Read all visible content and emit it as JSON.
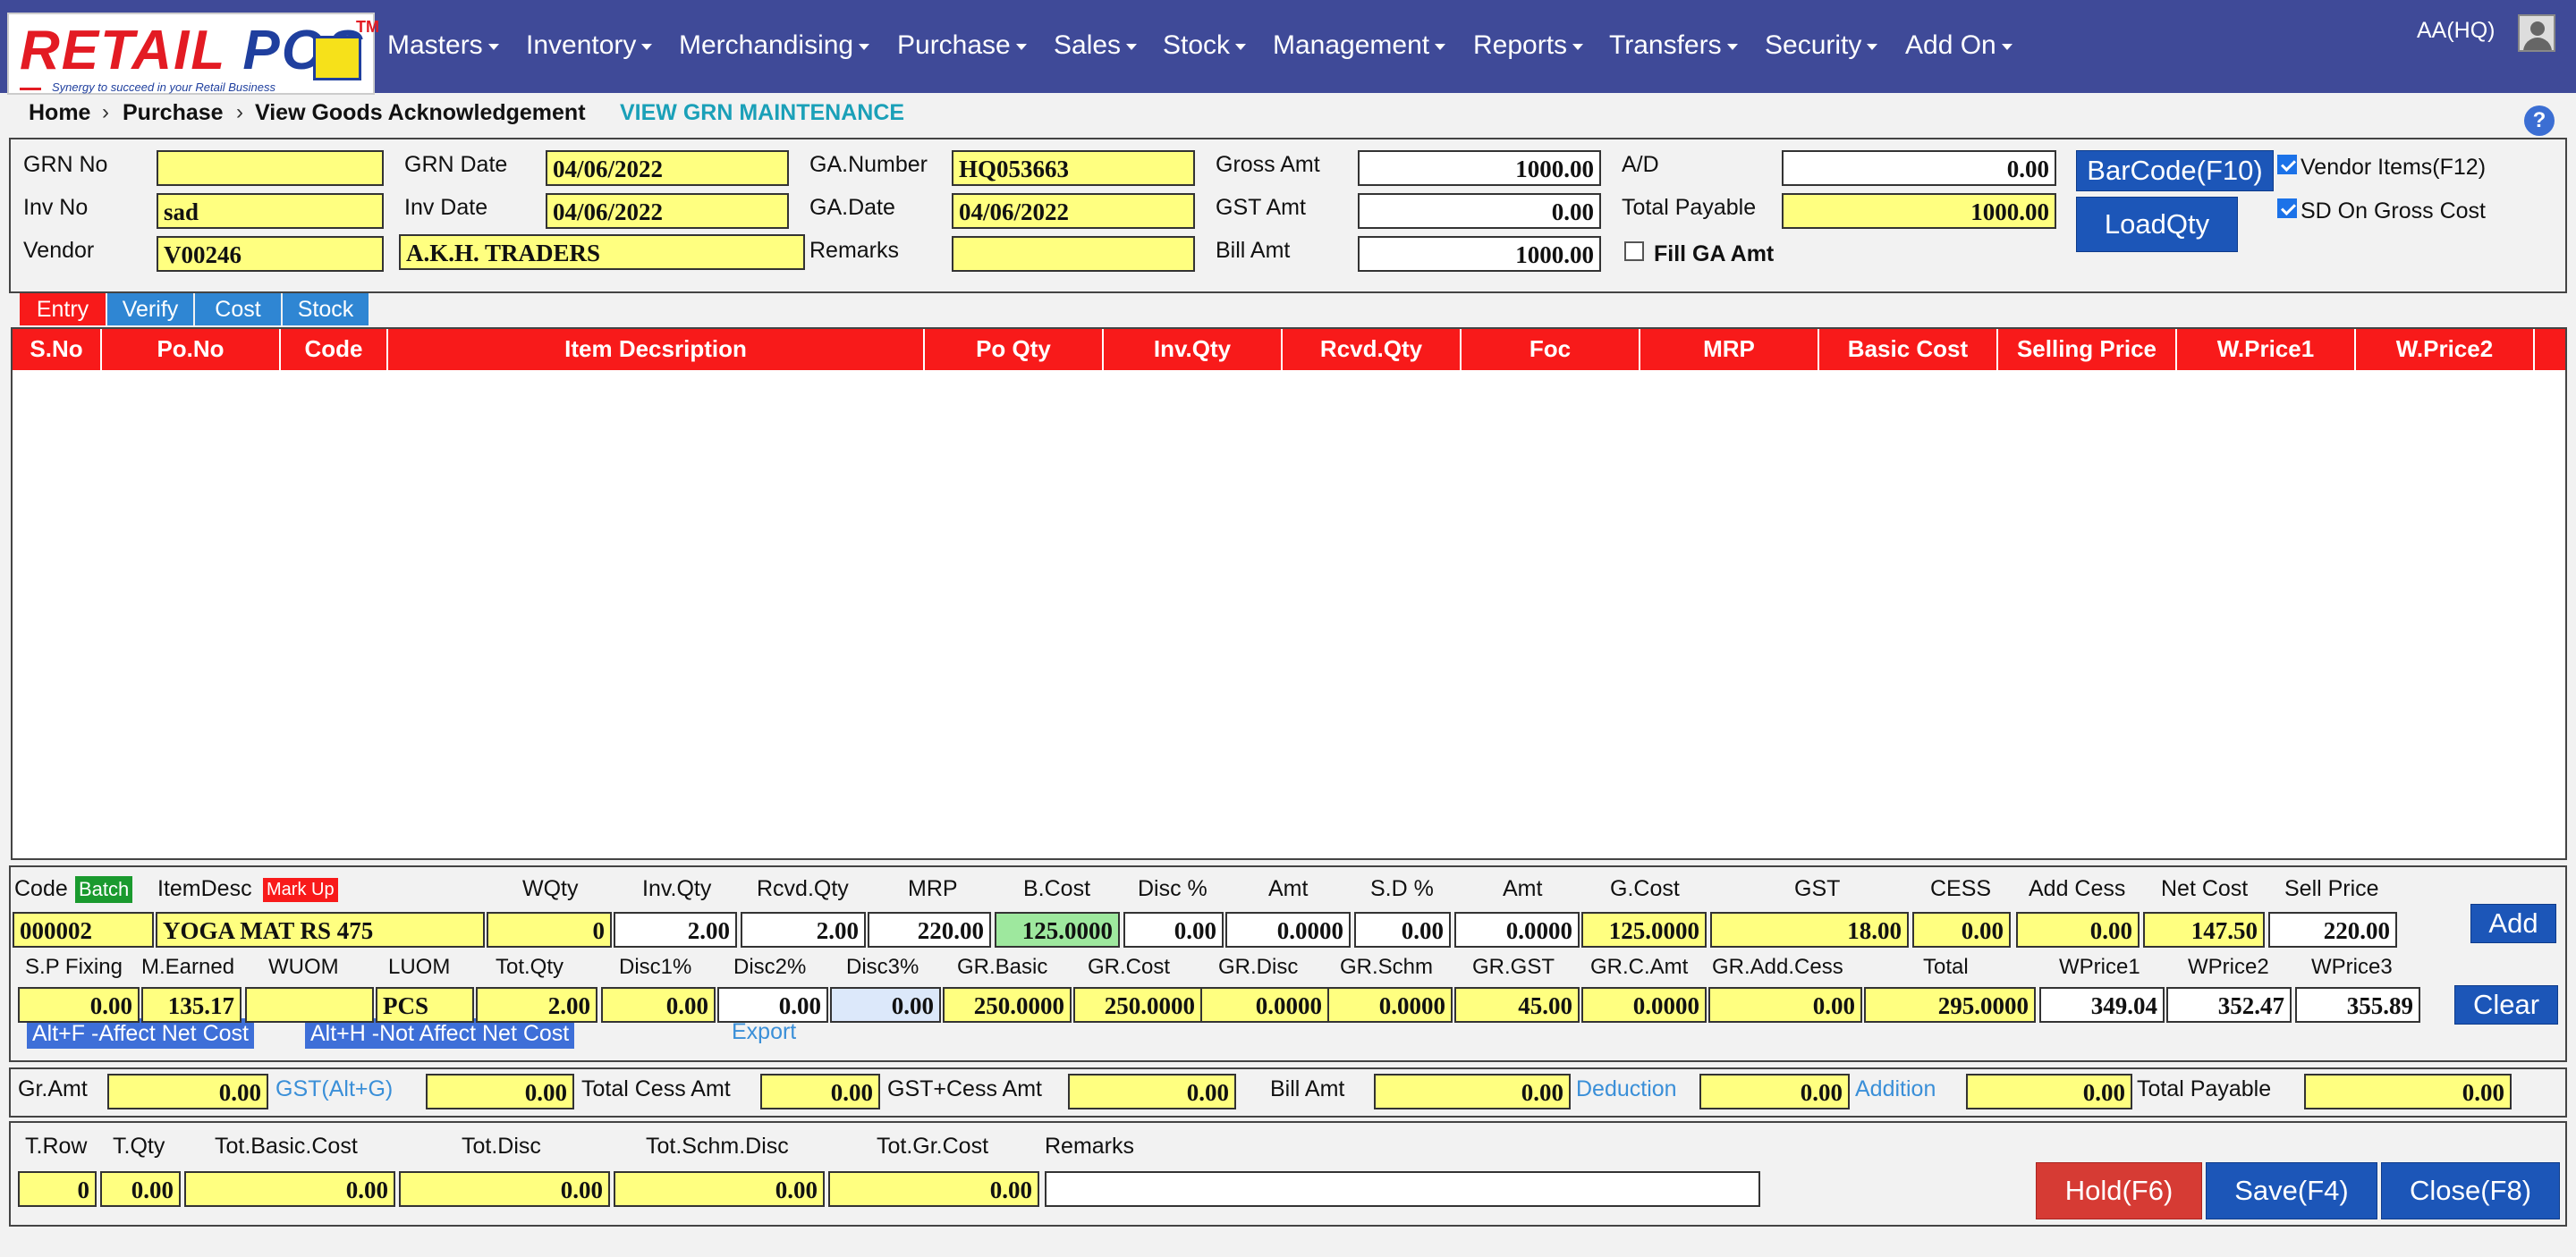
{
  "brand": {
    "logo_text_a": "RETAIL ",
    "logo_text_b": "POS",
    "tm": "TM",
    "tagline": "Synergy to succeed in your Retail Business"
  },
  "menu": [
    "Masters",
    "Inventory",
    "Merchandising",
    "Purchase",
    "Sales",
    "Stock",
    "Management",
    "Reports",
    "Transfers",
    "Security",
    "Add On"
  ],
  "user": "AA(HQ)",
  "breadcrumb": {
    "home": "Home",
    "section": "Purchase",
    "page": "View Goods Acknowledgement",
    "sep": "›",
    "link": "VIEW GRN MAINTENANCE"
  },
  "help": "?",
  "header": {
    "grn_no_label": "GRN No",
    "grn_no": "",
    "grn_date_label": "GRN Date",
    "grn_date": "04/06/2022",
    "ga_number_label": "GA.Number",
    "ga_number": "HQ053663",
    "gross_amt_label": "Gross Amt",
    "gross_amt": "1000.00",
    "ad_label": "A/D",
    "ad": "0.00",
    "inv_no_label": "Inv No",
    "inv_no": "sad",
    "inv_date_label": "Inv Date",
    "inv_date": "04/06/2022",
    "ga_date_label": "GA.Date",
    "ga_date": "04/06/2022",
    "gst_amt_label": "GST Amt",
    "gst_amt": "0.00",
    "total_payable_label": "Total Payable",
    "total_payable": "1000.00",
    "vendor_label": "Vendor",
    "vendor_code": "V00246",
    "vendor_name": "A.K.H. TRADERS",
    "remarks_label": "Remarks",
    "remarks": "",
    "bill_amt_label": "Bill Amt",
    "bill_amt": "1000.00",
    "fill_ga_label": "Fill GA Amt",
    "fill_ga_checked": false,
    "barcode_btn": "BarCode(F10)",
    "loadqty_btn": "LoadQty",
    "vendor_items_label": "Vendor Items(F12)",
    "vendor_items_checked": true,
    "sd_gross_label": "SD On Gross Cost",
    "sd_gross_checked": true
  },
  "tabs": [
    "Entry",
    "Verify",
    "Cost",
    "Stock"
  ],
  "grid_columns": [
    "S.No",
    "Po.No",
    "Code",
    "Item Decsription",
    "Po Qty",
    "Inv.Qty",
    "Rcvd.Qty",
    "Foc",
    "MRP",
    "Basic Cost",
    "Selling Price",
    "W.Price1",
    "W.Price2"
  ],
  "item": {
    "row1_labels": [
      "Code",
      "ItemDesc",
      "WQty",
      "Inv.Qty",
      "Rcvd.Qty",
      "MRP",
      "B.Cost",
      "Disc %",
      "Amt",
      "S.D %",
      "Amt",
      "G.Cost",
      "GST",
      "CESS",
      "Add Cess",
      "Net Cost",
      "Sell Price"
    ],
    "batch_badge": "Batch",
    "markup_badge": "Mark Up",
    "row1_values": [
      "000002",
      "YOGA MAT RS 475",
      "0",
      "2.00",
      "2.00",
      "220.00",
      "125.0000",
      "0.00",
      "0.0000",
      "0.00",
      "0.0000",
      "125.0000",
      "18.00",
      "0.00",
      "0.00",
      "147.50",
      "220.00"
    ],
    "row2_labels": [
      "S.P Fixing",
      "M.Earned",
      "WUOM",
      "LUOM",
      "Tot.Qty",
      "Disc1%",
      "Disc2%",
      "Disc3%",
      "GR.Basic",
      "GR.Cost",
      "GR.Disc",
      "GR.Schm",
      "GR.GST",
      "GR.C.Amt",
      "GR.Add.Cess",
      "Total",
      "WPrice1",
      "WPrice2",
      "WPrice3"
    ],
    "row2_values": [
      "0.00",
      "135.17",
      "",
      "PCS",
      "2.00",
      "0.00",
      "0.00",
      "0.00",
      "250.0000",
      "250.0000",
      "0.0000",
      "0.0000",
      "45.00",
      "0.0000",
      "0.00",
      "295.0000",
      "349.04",
      "352.47",
      "355.89"
    ],
    "hint_f": "Alt+F -Affect Net Cost",
    "hint_h": "Alt+H -Not Affect Net Cost",
    "export": "Export",
    "add_btn": "Add",
    "clear_btn": "Clear"
  },
  "totals": {
    "gr_amt_label": "Gr.Amt",
    "gr_amt": "0.00",
    "gst_link": "GST(Alt+G)",
    "gst": "0.00",
    "cess_label": "Total Cess Amt",
    "cess": "0.00",
    "gst_cess_label": "GST+Cess Amt",
    "gst_cess": "0.00",
    "bill_label": "Bill Amt",
    "bill": "0.00",
    "deduction_link": "Deduction",
    "deduction": "0.00",
    "addition_link": "Addition",
    "addition": "0.00",
    "payable_label": "Total Payable",
    "payable": "0.00"
  },
  "footer": {
    "labels": [
      "T.Row",
      "T.Qty",
      "Tot.Basic.Cost",
      "Tot.Disc",
      "Tot.Schm.Disc",
      "Tot.Gr.Cost",
      "Remarks"
    ],
    "values": [
      "0",
      "0.00",
      "0.00",
      "0.00",
      "0.00",
      "0.00",
      ""
    ],
    "hold_btn": "Hold(F6)",
    "save_btn": "Save(F4)",
    "close_btn": "Close(F8)"
  },
  "colors": {
    "nav": "#3f4a98",
    "grid_header": "#f81a1a",
    "tab_active": "#f81a1a",
    "tab": "#2f86d3",
    "field": "#ffff80",
    "button": "#1c56b8",
    "hold": "#d63b34"
  }
}
